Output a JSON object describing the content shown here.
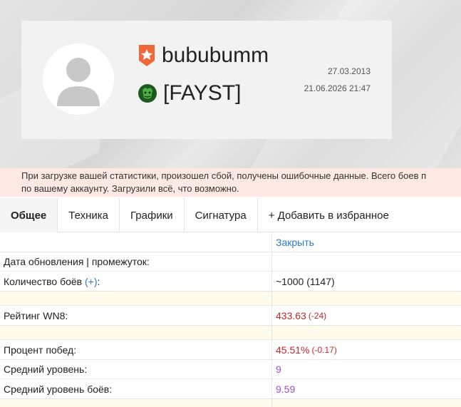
{
  "profile": {
    "nickname": "bububumm",
    "clan": "[FAYST]",
    "registration_date": "27.03.2013",
    "last_battle": "21.06.2026 21:47",
    "accent": "#f0683a"
  },
  "alert": {
    "line1": "При загрузке вашей статистики, произошел сбой, получены ошибочные данные. Всего боев п",
    "line2": "по вашему аккаунту. Загрузили всё, что возможно."
  },
  "tabs": [
    {
      "label": "Общее",
      "active": true
    },
    {
      "label": "Техника"
    },
    {
      "label": "Графики"
    },
    {
      "label": "Сигнатура"
    },
    {
      "label": "+ Добавить в избранное"
    }
  ],
  "stats": {
    "close_label": "Закрыть",
    "update_label": "Дата обновления | промежуток:",
    "battles_label": "Количество боёв",
    "battles_plus": "(+)",
    "battles_colon": ":",
    "battles_value": "~1000 (1147)",
    "wn8_label": "Рейтинг WN8:",
    "wn8_value": "433.63",
    "wn8_delta": "(-24)",
    "winrate_label": "Процент побед:",
    "winrate_value": "45.51%",
    "winrate_delta": "(-0.17)",
    "avg_tier_label": "Средний уровень:",
    "avg_tier_value": "9",
    "avg_battle_tier_label": "Средний уровень боёв:",
    "avg_battle_tier_value": "9.59"
  }
}
